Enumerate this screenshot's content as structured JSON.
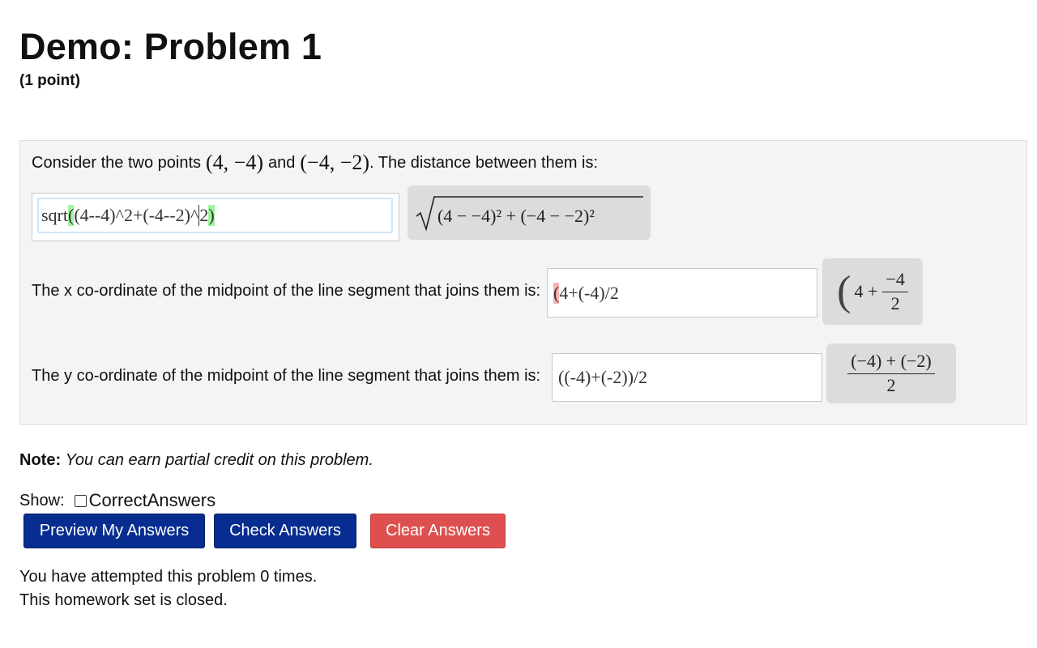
{
  "header": {
    "title": "Demo: Problem 1",
    "points": "(1 point)"
  },
  "problem": {
    "q1": {
      "text_before": "Consider the two points",
      "point_a": "(4, −4)",
      "text_mid": "and",
      "point_b": "(−4, −2)",
      "text_after": ". The distance between them is:",
      "answer_pre": "sqrt",
      "answer_paren_open": "(",
      "answer_mid": "(4--4)^2+(-4--2)^",
      "answer_last": "2",
      "answer_paren_close": ")",
      "preview": "(4 − −4)² + (−4 − −2)²"
    },
    "q2": {
      "text": "The x co-ordinate of the midpoint of the line segment that joins them is:",
      "answer_open": "(",
      "answer_rest": "4+(-4)/2",
      "preview_open": "(",
      "preview_term": "4 +",
      "preview_num": "−4",
      "preview_den": "2"
    },
    "q3": {
      "text": "The y co-ordinate of the midpoint of the line segment that joins them is:",
      "answer": "((-4)+(-2))/2",
      "preview_num": "(−4) + (−2)",
      "preview_den": "2"
    }
  },
  "note": {
    "label": "Note:",
    "text": "You can earn partial credit on this problem."
  },
  "show": {
    "label": "Show:",
    "option": "CorrectAnswers",
    "checked": false
  },
  "buttons": {
    "preview": "Preview My Answers",
    "check": "Check Answers",
    "clear": "Clear Answers"
  },
  "status": {
    "attempts": "You have attempted this problem 0 times.",
    "closed": "This homework set is closed."
  },
  "colors": {
    "primary_button": "#062d8f",
    "danger_button": "#de5050",
    "match_highlight": "#9ff49f",
    "error_highlight": "#f7b3b3"
  }
}
